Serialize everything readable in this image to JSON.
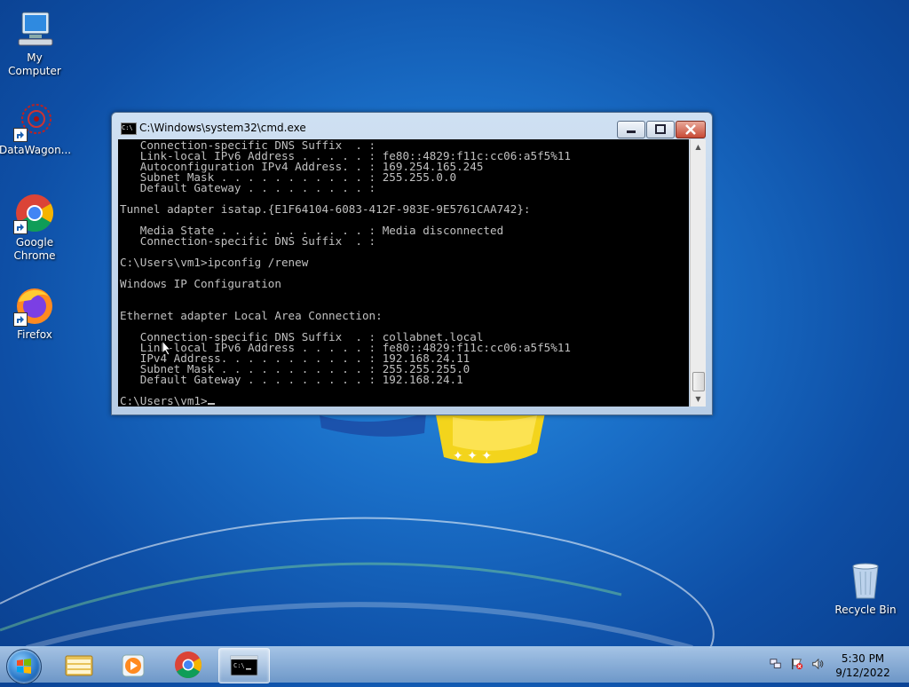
{
  "desktop": {
    "icons": [
      {
        "label": "My Computer"
      },
      {
        "label": "DataWagon..."
      },
      {
        "label": "Google Chrome"
      },
      {
        "label": "Firefox"
      },
      {
        "label": "Recycle Bin"
      }
    ]
  },
  "cmd_window": {
    "title": "C:\\Windows\\system32\\cmd.exe",
    "icon_text": "C:\\",
    "lines": [
      "   Connection-specific DNS Suffix  . :",
      "   Link-local IPv6 Address . . . . . : fe80::4829:f11c:cc06:a5f5%11",
      "   Autoconfiguration IPv4 Address. . : 169.254.165.245",
      "   Subnet Mask . . . . . . . . . . . : 255.255.0.0",
      "   Default Gateway . . . . . . . . . :",
      "",
      "Tunnel adapter isatap.{E1F64104-6083-412F-983E-9E5761CAA742}:",
      "",
      "   Media State . . . . . . . . . . . : Media disconnected",
      "   Connection-specific DNS Suffix  . :",
      "",
      "C:\\Users\\vm1>ipconfig /renew",
      "",
      "Windows IP Configuration",
      "",
      "",
      "Ethernet adapter Local Area Connection:",
      "",
      "   Connection-specific DNS Suffix  . : collabnet.local",
      "   Link-local IPv6 Address . . . . . : fe80::4829:f11c:cc06:a5f5%11",
      "   IPv4 Address. . . . . . . . . . . : 192.168.24.11",
      "   Subnet Mask . . . . . . . . . . . : 255.255.255.0",
      "   Default Gateway . . . . . . . . . : 192.168.24.1",
      ""
    ],
    "prompt": "C:\\Users\\vm1>"
  },
  "taskbar": {
    "buttons": [
      {
        "icon": "windows-explorer-icon"
      },
      {
        "icon": "media-player-icon"
      },
      {
        "icon": "chrome-icon"
      },
      {
        "icon": "cmd-icon",
        "active": true
      }
    ],
    "tray_icons": [
      "network-icon",
      "action-center-flag-icon",
      "volume-icon"
    ],
    "clock_time": "5:30 PM",
    "clock_date": "9/12/2022"
  }
}
